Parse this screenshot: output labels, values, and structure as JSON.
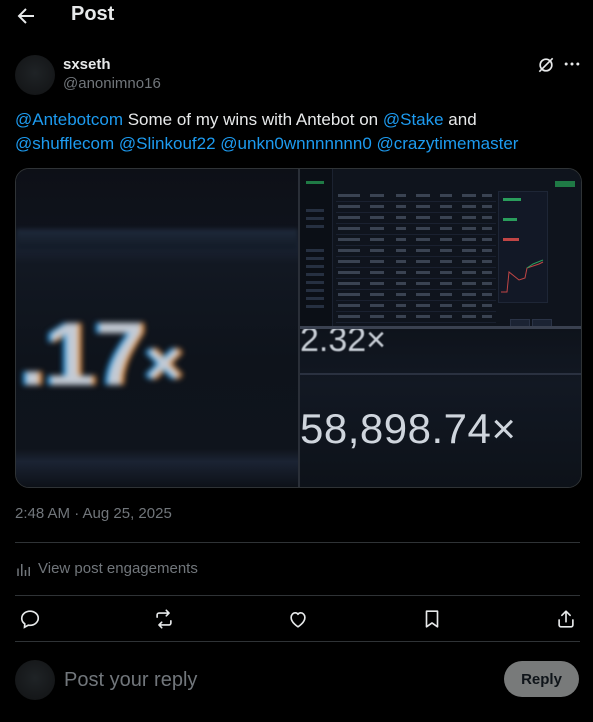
{
  "header": {
    "title": "Post",
    "back_icon": "arrow-left-icon"
  },
  "post": {
    "author_name": "sxseth",
    "author_handle": "@anonimno16",
    "grok_icon": "grok-icon",
    "more_icon": "more-horizontal-icon",
    "text_segments": [
      {
        "type": "mention",
        "text": "@Antebotcom"
      },
      {
        "type": "text",
        "text": " Some of my wins with Antebot on "
      },
      {
        "type": "mention",
        "text": "@Stake"
      },
      {
        "type": "text",
        "text": " and "
      },
      {
        "type": "mention",
        "text": "@shufflecom"
      },
      {
        "type": "text",
        "text": " "
      },
      {
        "type": "mention",
        "text": "@Slinkouf22"
      },
      {
        "type": "text",
        "text": " "
      },
      {
        "type": "mention",
        "text": "@unkn0wnnnnnnn0"
      },
      {
        "type": "text",
        "text": " "
      },
      {
        "type": "mention",
        "text": "@crazytimemaster"
      }
    ],
    "media": {
      "left_multiplier": ".17",
      "left_suffix": "×",
      "right_bottom_fragment": "2.32×",
      "right_bottom_multiplier": "58,898.74×"
    },
    "timestamp": "2:48 AM · Aug 25, 2025",
    "engagements_label": "View post engagements",
    "engagements_icon": "analytics-bars-icon"
  },
  "actions": [
    {
      "name": "reply",
      "icon": "comment-icon"
    },
    {
      "name": "repost",
      "icon": "repost-icon"
    },
    {
      "name": "like",
      "icon": "heart-icon"
    },
    {
      "name": "bookmark",
      "icon": "bookmark-icon"
    },
    {
      "name": "share",
      "icon": "share-icon"
    }
  ],
  "reply": {
    "placeholder": "Post your reply",
    "button_label": "Reply"
  },
  "colors": {
    "accent": "#1d9bf0",
    "muted": "#71767b",
    "text": "#e7e9ea",
    "bg": "#000000",
    "divider": "#2f3336"
  }
}
